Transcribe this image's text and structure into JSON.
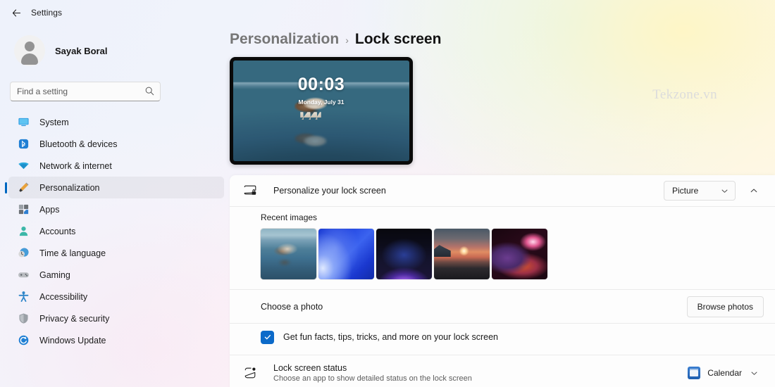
{
  "window": {
    "back_label": "back-arrow",
    "title": "Settings"
  },
  "sidebar": {
    "profile": {
      "name": "Sayak Boral"
    },
    "search": {
      "placeholder": "Find a setting",
      "value": ""
    },
    "items": [
      {
        "label": "System",
        "icon": "monitor-icon",
        "active": false
      },
      {
        "label": "Bluetooth & devices",
        "icon": "bluetooth-icon",
        "active": false
      },
      {
        "label": "Network & internet",
        "icon": "wifi-icon",
        "active": false
      },
      {
        "label": "Personalization",
        "icon": "paintbrush-icon",
        "active": true
      },
      {
        "label": "Apps",
        "icon": "apps-icon",
        "active": false
      },
      {
        "label": "Accounts",
        "icon": "person-icon",
        "active": false
      },
      {
        "label": "Time & language",
        "icon": "clock-globe-icon",
        "active": false
      },
      {
        "label": "Gaming",
        "icon": "gamepad-icon",
        "active": false
      },
      {
        "label": "Accessibility",
        "icon": "accessibility-icon",
        "active": false
      },
      {
        "label": "Privacy & security",
        "icon": "shield-icon",
        "active": false
      },
      {
        "label": "Windows Update",
        "icon": "update-icon",
        "active": false
      }
    ]
  },
  "breadcrumb": {
    "parent": "Personalization",
    "separator": "›",
    "current": "Lock screen"
  },
  "preview": {
    "time": "00:03",
    "date": "Monday, July 31"
  },
  "watermark": "Tekzone.vn",
  "settings": {
    "personalize": {
      "icon": "screen-lock-icon",
      "title": "Personalize your lock screen",
      "dropdown_value": "Picture",
      "expand_state": "expanded",
      "collapse_icon": "chevron-up-icon",
      "dropdown_icon": "chevron-down-icon"
    },
    "recent_images": {
      "title": "Recent images",
      "thumbnails": [
        {
          "name": "wolf-on-ice",
          "selected": true
        },
        {
          "name": "blue-bloom",
          "selected": false
        },
        {
          "name": "purple-glow",
          "selected": false
        },
        {
          "name": "sunset-coast",
          "selected": false
        },
        {
          "name": "red-swirl",
          "selected": false
        }
      ]
    },
    "choose_photo": {
      "label": "Choose a photo",
      "button_label": "Browse photos"
    },
    "fun_facts": {
      "label": "Get fun facts, tips, tricks, and more on your lock screen",
      "checked": true
    },
    "lock_screen_status": {
      "icon": "status-badge-icon",
      "title": "Lock screen status",
      "subtitle": "Choose an app to show detailed status on the lock screen",
      "value": "Calendar",
      "value_icon": "calendar-icon",
      "dropdown_icon": "chevron-down-icon"
    }
  },
  "colors": {
    "accent": "#0067c0",
    "checkbox": "#0c6ac9"
  }
}
